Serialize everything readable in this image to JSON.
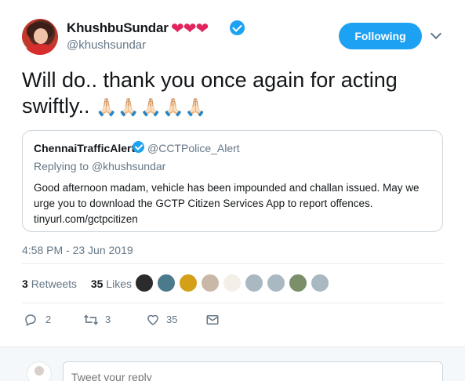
{
  "tweet": {
    "display_name": "KhushbuSundar",
    "hearts": "❤❤❤",
    "handle": "@khushsundar",
    "follow_label": "Following",
    "text": "Will do.. thank you once again for acting swiftly..",
    "emoji": "🙏🏻🙏🏻🙏🏻🙏🏻🙏🏻",
    "timestamp": "4:58 PM - 23 Jun 2019"
  },
  "quote": {
    "display_name": "ChennaiTrafficAlert",
    "handle": "@CCTPolice_Alert",
    "replying_prefix": "Replying to",
    "replying_to": "@khushsundar",
    "body": "Good afternoon madam, vehicle has been impounded and challan issued. May we urge you to download the GCTP Citizen Services App to report offences. tinyurl.com/gctpcitizen"
  },
  "stats": {
    "retweets_count": "3",
    "retweets_label": "Retweets",
    "likes_count": "35",
    "likes_label": "Likes"
  },
  "actions": {
    "reply_count": "2",
    "retweet_count": "3",
    "like_count": "35"
  },
  "reply_box": {
    "placeholder": "Tweet your reply"
  },
  "colors": {
    "accent": "#1da1f2",
    "muted": "#657786",
    "heart": "#e0245e"
  }
}
